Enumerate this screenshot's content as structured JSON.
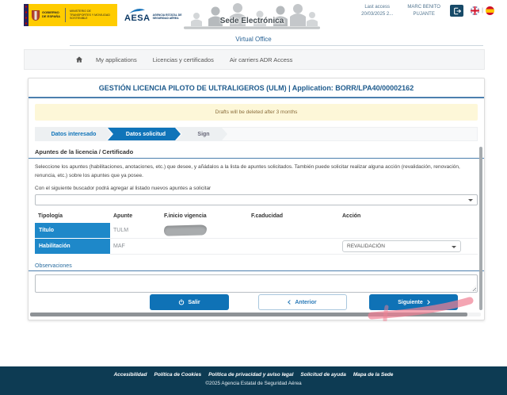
{
  "header": {
    "gobierno": {
      "line1": "GOBIERNO DE ESPAÑA",
      "ministry": "MINISTERIO DE TRANSPORTES Y MOVILIDAD SOSTENIBLE"
    },
    "aesa": {
      "acronym": "AESA",
      "subtitle": "AGENCIA ESTATAL DE SEGURIDAD AÉREA"
    },
    "banner_title": "Sede Electrónica",
    "last_access_label": "Last access",
    "last_access_value": "20/03/2025 2...",
    "user_name": "MARC BENITO PUJANTE",
    "language_separator": "|",
    "virtual_office": "Virtual Office"
  },
  "nav": {
    "items": [
      {
        "label": "My applications"
      },
      {
        "label": "Licencias y certificados"
      },
      {
        "label": "Air carriers ADR Access"
      }
    ]
  },
  "main": {
    "title": "GESTIÓN LICENCIA PILOTO DE ULTRALIGEROS (ULM) | Application: BORR/LPA40/00002162",
    "alert": "Drafts will be deleted after 3 months",
    "steps": [
      {
        "label": "Datos interesado",
        "state": "done"
      },
      {
        "label": "Datos solicitud",
        "state": "active"
      },
      {
        "label": "Sign",
        "state": "pending"
      }
    ],
    "section_title": "Apuntes de la licencia / Certificado",
    "description": "Seleccione los apuntes (habilitaciones, anotaciones, etc.) que desee, y añádalos a la lista de apuntes solicitados. También puede solicitar realizar alguna acción (revalidación, renovación, renuncia, etc.) sobre los apuntes que ya posee.",
    "search_label": "Con el siguiente buscador podrá agregar al listado nuevos apuntes a solicitar",
    "search_select_value": "",
    "table": {
      "headers": [
        "Tipología",
        "Apunte",
        "F.inicio vigencia",
        "F.caducidad",
        "Acción"
      ],
      "rows": [
        {
          "tipologia": "Título",
          "apunte": "TULM",
          "f_inicio": "[redacted]",
          "f_caducidad": "",
          "accion": ""
        },
        {
          "tipologia": "Habilitación",
          "apunte": "MAF",
          "f_inicio": "",
          "f_caducidad": "",
          "accion": "REVALIDACIÓN"
        }
      ]
    },
    "observaciones_label": "Observaciones",
    "observaciones_value": "",
    "buttons": {
      "salir": "Salir",
      "anterior": "Anterior",
      "siguiente": "Siguiente"
    }
  },
  "footer": {
    "links": [
      "Accesibilidad",
      "Política de Cookies",
      "Política de privacidad y aviso legal",
      "Solicitud de ayuda",
      "Mapa de la Sede"
    ],
    "copyright": "©2025 Agencia Estatal de Seguridad Aérea"
  },
  "colors": {
    "accent_blue": "#0f72b6",
    "table_blue": "#1e88c9",
    "title_navy": "#1d5a8c",
    "footer_navy": "#0d3b53",
    "alert_bg": "#fdf7d8",
    "alert_text": "#8a6d3b",
    "annotation_pink": "#ef7f93"
  }
}
